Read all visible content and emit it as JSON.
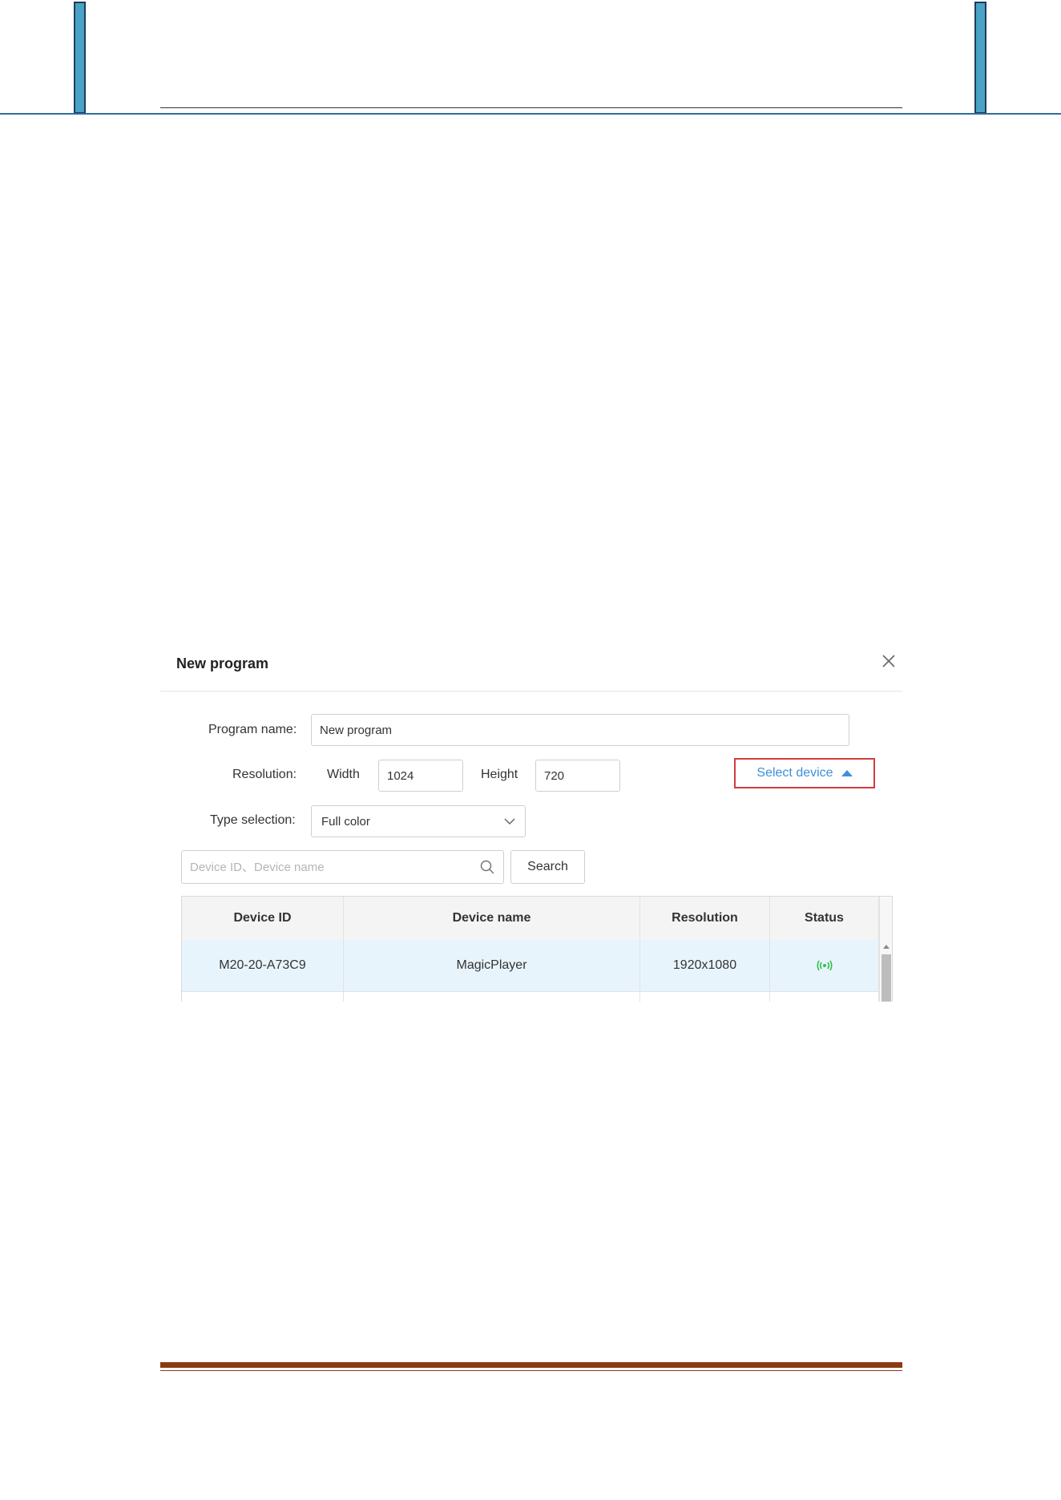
{
  "dialog": {
    "title": "New program",
    "program_name_label": "Program name:",
    "program_name_value": "New program",
    "resolution_label": "Resolution:",
    "width_label": "Width",
    "width_value": "1024",
    "height_label": "Height",
    "height_value": "720",
    "select_device_label": "Select device",
    "type_selection_label": "Type selection:",
    "type_selection_value": "Full color",
    "search_placeholder": "Device ID、Device name",
    "search_button_label": "Search"
  },
  "table": {
    "columns": [
      "Device ID",
      "Device name",
      "Resolution",
      "Status"
    ],
    "rows": [
      {
        "device_id": "M20-20-A73C9",
        "device_name": "MagicPlayer",
        "resolution": "1920x1080",
        "status_icon": "online-signal-icon"
      }
    ]
  },
  "colors": {
    "accent_blue": "#3f8fd8",
    "highlight_red": "#d23c3c",
    "status_green": "#2fbf4a",
    "row_highlight": "#e8f4fc"
  }
}
